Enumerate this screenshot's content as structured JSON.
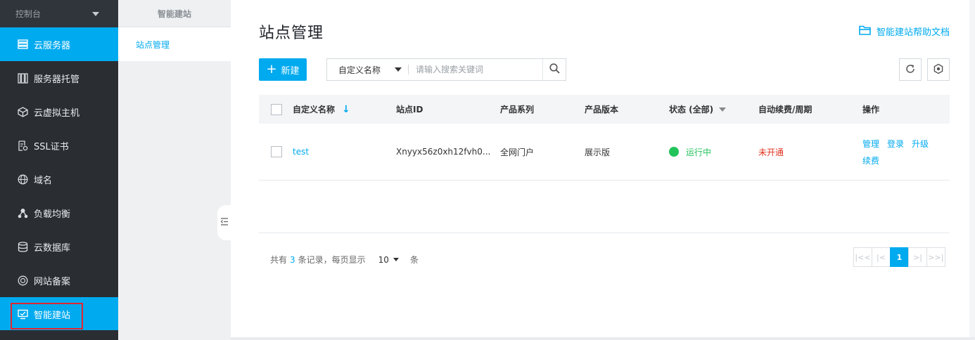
{
  "sidebar": {
    "console_label": "控制台",
    "items": [
      {
        "label": "云服务器",
        "icon": "server-list-icon"
      },
      {
        "label": "服务器托管",
        "icon": "rack-icon"
      },
      {
        "label": "云虚拟主机",
        "icon": "cube-icon"
      },
      {
        "label": "SSL证书",
        "icon": "certificate-icon"
      },
      {
        "label": "域名",
        "icon": "globe-icon"
      },
      {
        "label": "负载均衡",
        "icon": "load-balance-icon"
      },
      {
        "label": "云数据库",
        "icon": "database-icon"
      },
      {
        "label": "网站备案",
        "icon": "record-badge-icon"
      },
      {
        "label": "智能建站",
        "icon": "monitor-icon"
      }
    ]
  },
  "subnav": {
    "title": "智能建站",
    "items": [
      {
        "label": "站点管理"
      }
    ]
  },
  "main": {
    "title": "站点管理",
    "help_link": "智能建站帮助文档",
    "new_button": "新建",
    "search": {
      "field_select": "自定义名称",
      "placeholder": "请输入搜索关键词"
    },
    "table": {
      "headers": {
        "name": "自定义名称",
        "site_id": "站点ID",
        "series": "产品系列",
        "version": "产品版本",
        "status": "状态 (全部)",
        "renew": "自动续费/周期",
        "ops": "操作"
      },
      "rows": [
        {
          "name": "test",
          "site_id": "Xnyyx56z0xh12fvh0...",
          "series": "全网门户",
          "version": "展示版",
          "status": "运行中",
          "renew": "未开通",
          "ops": [
            "管理",
            "登录",
            "升级",
            "续费"
          ]
        }
      ]
    },
    "pagination": {
      "prefix": "共有",
      "total": "3",
      "middle": "条记录，每页显示",
      "page_size": "10",
      "unit": "条",
      "current_page": "1"
    }
  },
  "colors": {
    "accent": "#00aaef",
    "sidebar_bg": "#2a2e33",
    "status_running": "#23c35b",
    "not_enabled": "#e0331e"
  }
}
